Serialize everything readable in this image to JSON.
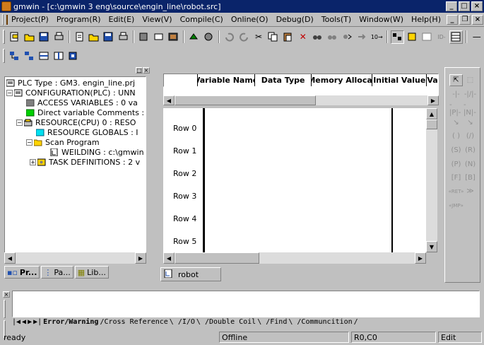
{
  "window": {
    "title": "gmwin - [c:\\gmwin 3 eng\\source\\engin_line\\robot.src]",
    "minimize": "_",
    "maximize": "□",
    "close": "×"
  },
  "menu": {
    "items": [
      "Project(P)",
      "Program(R)",
      "Edit(E)",
      "View(V)",
      "Compile(C)",
      "Online(O)",
      "Debug(D)",
      "Tools(T)",
      "Window(W)",
      "Help(H)"
    ],
    "mdi_minimize": "_",
    "mdi_restore": "❐",
    "mdi_close": "×"
  },
  "toolbar": {
    "icons": [
      "new-project",
      "open-project",
      "save-project",
      "print",
      "new-program",
      "open-program",
      "save-program",
      "print-program",
      "cut-block",
      "print-preview",
      "compile",
      "make",
      "undo",
      "redo",
      "cut",
      "copy",
      "paste",
      "delete",
      "find",
      "replace",
      "find-next",
      "goto",
      "zoom-in",
      "zoom-out",
      "monitor",
      "io-mode",
      "variable-view"
    ],
    "row2_icons": [
      "connect",
      "download",
      "run",
      "stop",
      "debug"
    ],
    "step_label": "10→"
  },
  "project_tree": {
    "nodes": [
      {
        "label": "PLC Type : GM3. engin_line.prj",
        "icon": "plc-icon",
        "level": 0
      },
      {
        "label": "CONFIGURATION(PLC) :  UNN",
        "icon": "config-icon",
        "level": 1,
        "expander": "−"
      },
      {
        "label": "ACCESS VARIABLES :  0 va",
        "icon": "gray-folder-icon",
        "level": 2
      },
      {
        "label": "Direct variable Comments :",
        "icon": "green-box-icon",
        "level": 2
      },
      {
        "label": "RESOURCE(CPU) 0 :  RESO",
        "icon": "cpu-icon",
        "level": 2,
        "expander": "−"
      },
      {
        "label": "RESOURCE GLOBALS :  I",
        "icon": "cyan-box-icon",
        "level": 3
      },
      {
        "label": "Scan Program",
        "icon": "open-folder-icon",
        "level": 3,
        "expander": "−"
      },
      {
        "label": "WEILDING : c:\\gmwin",
        "icon": "document-icon",
        "level": 4
      },
      {
        "label": "TASK DEFINITIONS :  2 v",
        "icon": "task-icon",
        "level": 3,
        "expander": "+"
      }
    ]
  },
  "left_tabs": [
    "Pr...",
    "Pa...",
    "Lib..."
  ],
  "variable_table": {
    "columns": [
      "Variable Name",
      "Data Type",
      "Memory Allocat",
      "Initial Value",
      "Va"
    ]
  },
  "ladder": {
    "rows": [
      "Row 0",
      "Row 1",
      "Row 2",
      "Row 3",
      "Row 4",
      "Row 5"
    ]
  },
  "editor_tab": "robot",
  "palette": {
    "buttons": [
      "⇱",
      "⬚",
      "-|-",
      "-|/|-",
      "-|P|-",
      "-|N|-",
      "↘",
      "↘",
      "( )",
      "(/)",
      "(S)",
      "(R)",
      "(P)",
      "(N)",
      "[F]",
      "[B]",
      "«RET»",
      "≫",
      "«JMP»"
    ]
  },
  "output": {
    "tabs": [
      "Error/Warning",
      "Cross Reference",
      "I/O",
      "Double Coil",
      "Find",
      "Communcition"
    ]
  },
  "status": {
    "message": "ready",
    "mode": "Offline",
    "position": "R0,C0",
    "edit_mode": "Edit"
  }
}
